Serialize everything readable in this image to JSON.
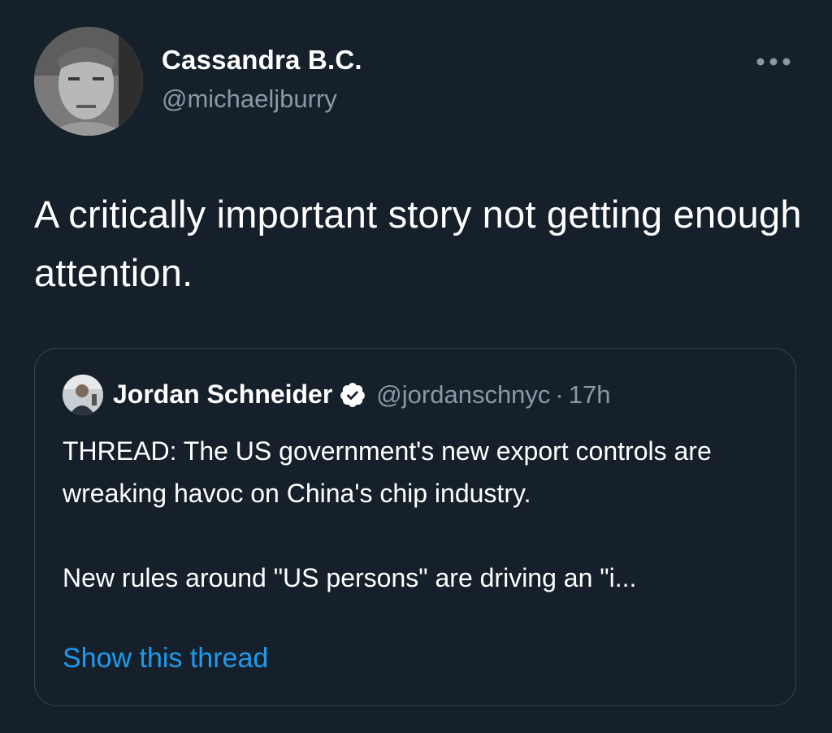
{
  "author": {
    "name": "Cassandra B.C.",
    "handle": "@michaeljburry"
  },
  "tweet": {
    "text": "A critically important story not getting enough attention."
  },
  "quoted_tweet": {
    "author_name": "Jordan Schneider",
    "handle": "@jordanschnyc",
    "separator": "·",
    "time": "17h",
    "verified": true,
    "paragraph_1": "THREAD: The US government's new export controls are wreaking havoc on China's chip industry.",
    "paragraph_2": "New rules around \"US persons\" are driving an \"i...",
    "show_thread_label": "Show this thread"
  },
  "icons": {
    "more": "more-horizontal-icon",
    "verified": "verified-badge-icon"
  },
  "colors": {
    "background": "#15202b",
    "primary_text": "#ffffff",
    "secondary_text": "#8b98a5",
    "link": "#1d9bf0",
    "border": "#38444d"
  }
}
